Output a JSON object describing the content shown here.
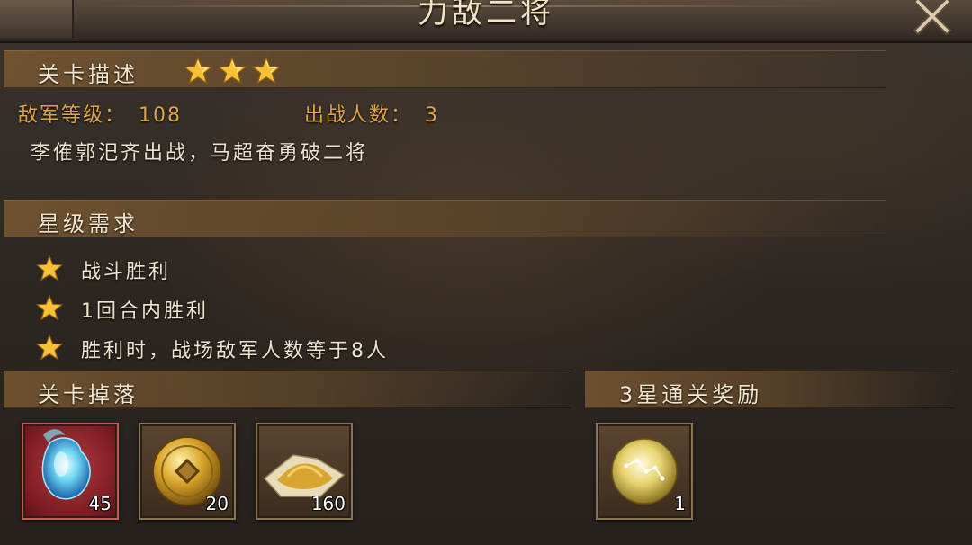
{
  "title": "力敌二将",
  "stage_desc": {
    "header": "关卡描述",
    "star_count": 3,
    "enemy_level_label": "敌军等级：",
    "enemy_level_value": "108",
    "troops_label": "出战人数：",
    "troops_value": "3",
    "description": "李傕郭汜齐出战，马超奋勇破二将"
  },
  "star_requirements": {
    "header": "星级需求",
    "items": [
      "战斗胜利",
      "1回合内胜利",
      "胜利时，战场敌军人数等于8人"
    ]
  },
  "drops": {
    "header": "关卡掉落",
    "items": [
      {
        "icon": "blue-crystal-icon",
        "count": "45"
      },
      {
        "icon": "gold-coin-icon",
        "count": "20"
      },
      {
        "icon": "grain-pile-icon",
        "count": "160"
      }
    ]
  },
  "reward": {
    "header": "3星通关奖励",
    "items": [
      {
        "icon": "golden-orb-icon",
        "count": "1"
      }
    ]
  },
  "colors": {
    "accent_gold": "#e0a54a",
    "star_gold": "#f6c136",
    "rare_red": "#9a2a30"
  }
}
